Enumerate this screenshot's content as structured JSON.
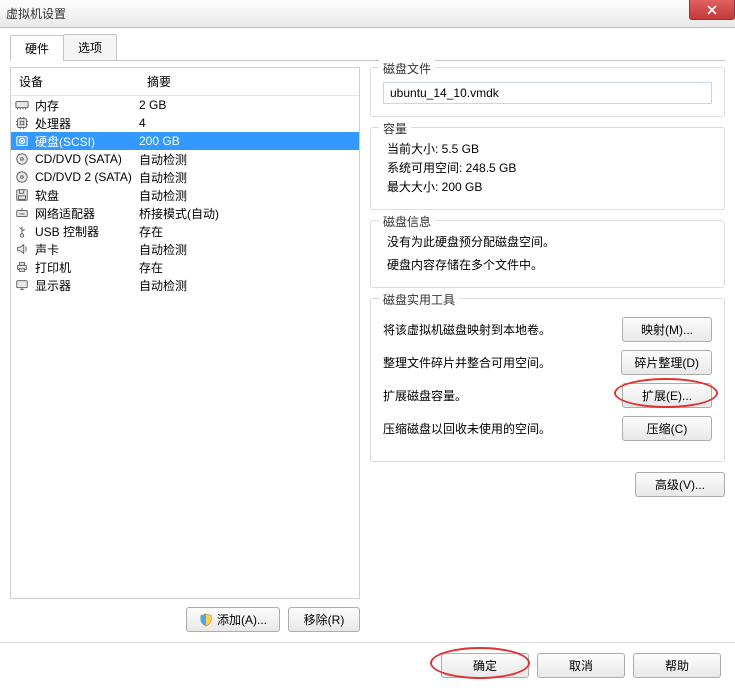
{
  "window": {
    "title": "虚拟机设置"
  },
  "tabs": {
    "hardware": "硬件",
    "options": "选项"
  },
  "list": {
    "col_device": "设备",
    "col_summary": "摘要",
    "rows": [
      {
        "name": "内存",
        "summary": "2 GB",
        "icon": "memory"
      },
      {
        "name": "处理器",
        "summary": "4",
        "icon": "cpu"
      },
      {
        "name": "硬盘(SCSI)",
        "summary": "200 GB",
        "icon": "hdd",
        "selected": true
      },
      {
        "name": "CD/DVD (SATA)",
        "summary": "自动检测",
        "icon": "cd"
      },
      {
        "name": "CD/DVD 2 (SATA)",
        "summary": "自动检测",
        "icon": "cd"
      },
      {
        "name": "软盘",
        "summary": "自动检测",
        "icon": "floppy"
      },
      {
        "name": "网络适配器",
        "summary": "桥接模式(自动)",
        "icon": "net"
      },
      {
        "name": "USB 控制器",
        "summary": "存在",
        "icon": "usb"
      },
      {
        "name": "声卡",
        "summary": "自动检测",
        "icon": "sound"
      },
      {
        "name": "打印机",
        "summary": "存在",
        "icon": "printer"
      },
      {
        "name": "显示器",
        "summary": "自动检测",
        "icon": "display"
      }
    ]
  },
  "left_buttons": {
    "add": "添加(A)...",
    "remove": "移除(R)"
  },
  "disk_file": {
    "title": "磁盘文件",
    "value": "ubuntu_14_10.vmdk"
  },
  "capacity": {
    "title": "容量",
    "current": "当前大小: 5.5 GB",
    "free": "系统可用空间: 248.5 GB",
    "max": "最大大小: 200 GB"
  },
  "disk_info": {
    "title": "磁盘信息",
    "line1": "没有为此硬盘预分配磁盘空间。",
    "line2": "硬盘内容存储在多个文件中。"
  },
  "utils": {
    "title": "磁盘实用工具",
    "map_desc": "将该虚拟机磁盘映射到本地卷。",
    "map_btn": "映射(M)...",
    "defrag_desc": "整理文件碎片并整合可用空间。",
    "defrag_btn": "碎片整理(D)",
    "expand_desc": "扩展磁盘容量。",
    "expand_btn": "扩展(E)...",
    "compact_desc": "压缩磁盘以回收未使用的空间。",
    "compact_btn": "压缩(C)"
  },
  "advanced_btn": "高级(V)...",
  "bottom": {
    "ok": "确定",
    "cancel": "取消",
    "help": "帮助"
  }
}
